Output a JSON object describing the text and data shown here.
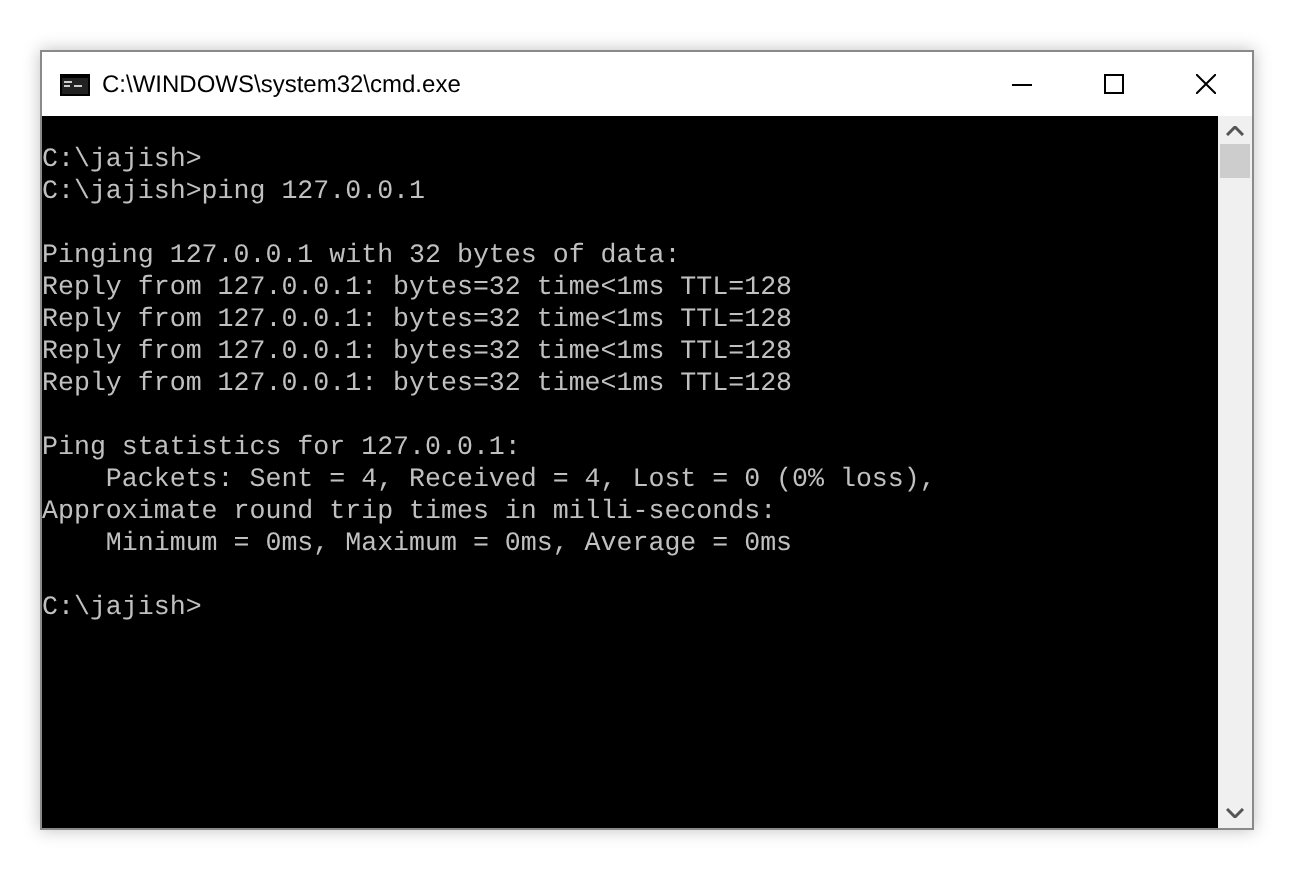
{
  "window": {
    "title": "C:\\WINDOWS\\system32\\cmd.exe"
  },
  "console": {
    "blocks": [
      [
        "C:\\jajish>",
        "C:\\jajish>ping 127.0.0.1"
      ],
      [
        "Pinging 127.0.0.1 with 32 bytes of data:",
        "Reply from 127.0.0.1: bytes=32 time<1ms TTL=128",
        "Reply from 127.0.0.1: bytes=32 time<1ms TTL=128",
        "Reply from 127.0.0.1: bytes=32 time<1ms TTL=128",
        "Reply from 127.0.0.1: bytes=32 time<1ms TTL=128"
      ],
      [
        "Ping statistics for 127.0.0.1:",
        "    Packets: Sent = 4, Received = 4, Lost = 0 (0% loss),",
        "Approximate round trip times in milli-seconds:",
        "    Minimum = 0ms, Maximum = 0ms, Average = 0ms"
      ],
      [
        "C:\\jajish>"
      ]
    ]
  }
}
